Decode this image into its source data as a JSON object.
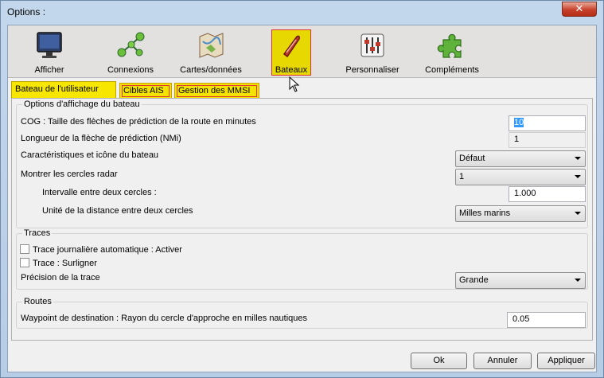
{
  "window": {
    "title": "Options :",
    "close_glyph": "✕"
  },
  "toolbar": {
    "items": [
      {
        "label": "Afficher",
        "icon": "monitor-icon"
      },
      {
        "label": "Connexions",
        "icon": "network-icon"
      },
      {
        "label": "Cartes/données",
        "icon": "map-icon"
      },
      {
        "label": "Bateaux",
        "icon": "boat-icon",
        "active": true
      },
      {
        "label": "Personnaliser",
        "icon": "sliders-icon"
      },
      {
        "label": "Compléments",
        "icon": "puzzle-icon"
      }
    ]
  },
  "tabs": [
    {
      "label": "Bateau de l'utilisateur",
      "selected": true
    },
    {
      "label": "Cibles AIS"
    },
    {
      "label": "Gestion des MMSI"
    }
  ],
  "display_options": {
    "legend": "Options d'affichage du bateau",
    "cog_label": "COG : Taille des flèches de prédiction de la route en minutes",
    "cog_value": "10",
    "length_label": "Longueur de la flèche de prédiction (NMi)",
    "length_value": "1",
    "icon_label": "Caractéristiques et icône du bateau",
    "icon_value": "Défaut",
    "radar_label": "Montrer les cercles radar",
    "radar_value": "1",
    "interval_label": "Intervalle entre deux cercles :",
    "interval_value": "1.000",
    "unit_label": "Unité de la distance entre deux cercles",
    "unit_value": "Milles marins"
  },
  "traces": {
    "legend": "Traces",
    "auto_label": "Trace journalière automatique : Activer",
    "highlight_label": "Trace : Surligner",
    "precision_label": "Précision de la trace",
    "precision_value": "Grande"
  },
  "routes": {
    "legend": "Routes",
    "waypoint_label": "Waypoint de destination : Rayon du cercle d'approche en milles nautiques",
    "waypoint_value": "0.05"
  },
  "buttons": {
    "ok": "Ok",
    "cancel": "Annuler",
    "apply": "Appliquer"
  },
  "colors": {
    "highlight": "#f4e300",
    "highlight_border": "#dd3333"
  }
}
